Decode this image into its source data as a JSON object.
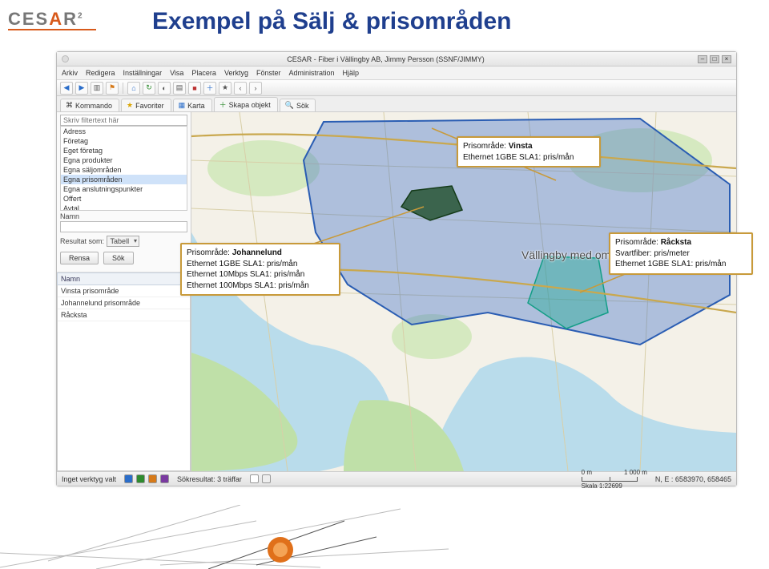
{
  "logo": {
    "part1": "CES",
    "part2_accent": "A",
    "part3": "R",
    "sup": "2"
  },
  "page_title": "Exempel på Sälj & prisområden",
  "app": {
    "window_title": "CESAR - Fiber i Vällingby AB, Jimmy Persson (SSNF/JIMMY)",
    "menu": [
      "Arkiv",
      "Redigera",
      "Inställningar",
      "Visa",
      "Placera",
      "Verktyg",
      "Fönster",
      "Administration",
      "Hjälp"
    ],
    "tabs": [
      {
        "icon": "⌂",
        "label": "Kommando"
      },
      {
        "icon": "★",
        "label": "Favoriter"
      },
      {
        "icon": "🗺",
        "label": "Karta"
      },
      {
        "icon": "＋",
        "label": "Skapa objekt"
      },
      {
        "icon": "🔍",
        "label": "Sök"
      }
    ],
    "sidebar": {
      "filter_placeholder": "Skriv filtertext här",
      "filter_items": [
        "Adress",
        "Företag",
        "Eget företag",
        "Egna produkter",
        "Egna säljområden",
        "Egna prisområden",
        "Egna anslutningspunkter",
        "Offert",
        "Avtal"
      ],
      "filter_selected_index": 5,
      "namn_label": "Namn",
      "resultat_label": "Resultat som:",
      "resultat_value": "Tabell",
      "btn_rensa": "Rensa",
      "btn_sok": "Sök",
      "result_header": "Namn",
      "results": [
        "Vinsta prisområde",
        "Johannelund prisområde",
        "Råcksta"
      ]
    },
    "map_center_label": "Vällingby med omnejd",
    "status": {
      "tool": "Inget verktyg valt",
      "hits": "Sökresultat: 3 träffar",
      "scale_left": "0 m",
      "scale_right": "1 000 m",
      "scale_ratio": "Skala 1:22699",
      "coords": "N, E : 6583970, 658465"
    }
  },
  "callouts": {
    "vinsta": {
      "line1_prefix": "Prisområde: ",
      "line1_bold": "Vinsta",
      "line2": "Ethernet 1GBE SLA1: pris/mån"
    },
    "johannelund": {
      "line1_prefix": "Prisområde: ",
      "line1_bold": "Johannelund",
      "line2": "Ethernet 1GBE SLA1:   pris/mån",
      "line3": "Ethernet 10Mbps SLA1: pris/mån",
      "line4": "Ethernet 100Mbps SLA1: pris/mån"
    },
    "racksta": {
      "line1_prefix": "Prisområde: ",
      "line1_bold": "Råcksta",
      "line2": "Svartfiber: pris/meter",
      "line3": "Ethernet 1GBE SLA1: pris/mån"
    }
  }
}
